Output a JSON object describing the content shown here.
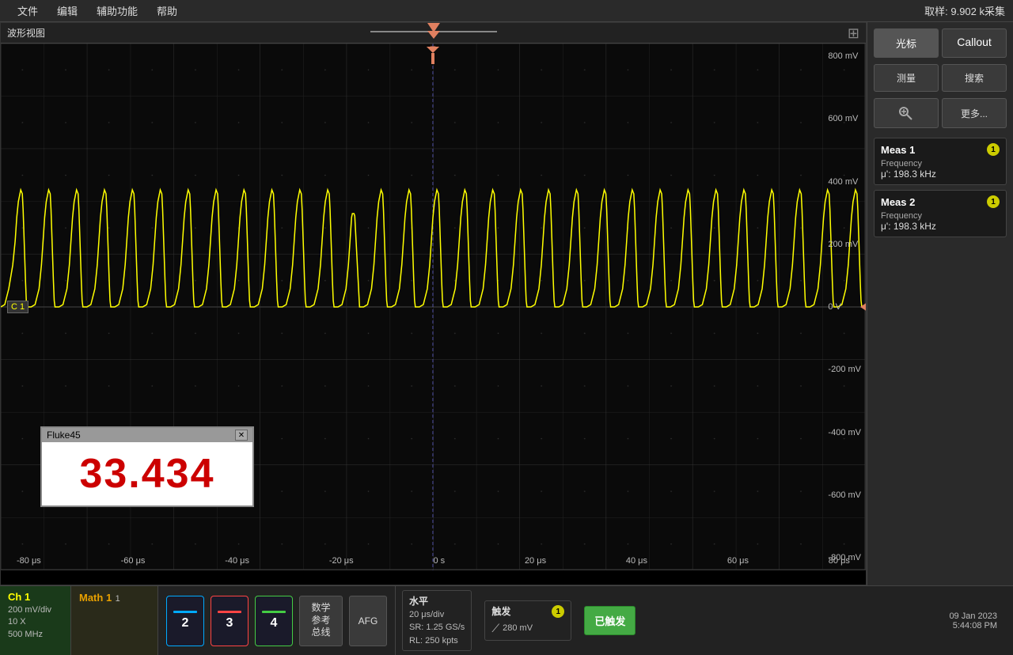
{
  "menubar": {
    "items": [
      "文件",
      "编辑",
      "辅助功能",
      "帮助"
    ],
    "sample_info": "取样: 9.902 k采集"
  },
  "right_panel": {
    "btn_cursor": "光标",
    "btn_callout": "Callout",
    "btn_measure": "测量",
    "btn_search": "搜索",
    "btn_zoom_icon": "⊕",
    "btn_more": "更多...",
    "meas1": {
      "title": "Meas 1",
      "badge": "1",
      "label1": "Frequency",
      "value1": "μ': 198.3 kHz"
    },
    "meas2": {
      "title": "Meas 2",
      "badge": "1",
      "label1": "Frequency",
      "value1": "μ': 198.3 kHz"
    }
  },
  "waveform": {
    "title": "波形视图",
    "y_labels": [
      "800 mV",
      "600 mV",
      "400 mV",
      "200 mV",
      "0 V",
      "-200 mV",
      "-400 mV",
      "-600 mV",
      "-800 mV"
    ],
    "x_labels": [
      "-80 μs",
      "-60 μs",
      "-40 μs",
      "-20 μs",
      "0 s",
      "20 μs",
      "40 μs",
      "60 μs",
      "80 μs"
    ],
    "ch1_label": "C 1"
  },
  "fluke_popup": {
    "title": "Fluke45",
    "close": "✕",
    "value": "33.434"
  },
  "bottom_bar": {
    "ch1": {
      "title": "Ch 1",
      "line1": "200 mV/div",
      "line2": "10 X",
      "line3": "500 MHz"
    },
    "math1": {
      "title": "Math 1",
      "value": "1"
    },
    "ch_buttons": [
      {
        "num": "2",
        "color": "#00aaff"
      },
      {
        "num": "3",
        "color": "#ff4444"
      },
      {
        "num": "4",
        "color": "#44cc44"
      }
    ],
    "math_btn": {
      "line1": "数学",
      "line2": "参考",
      "line3": "总线"
    },
    "afg_btn": "AFG",
    "horiz": {
      "label": "水平",
      "line1": "20 μs/div",
      "line2": "SR: 1.25 GS/s",
      "line3": "RL: 250 kpts"
    },
    "trigger": {
      "label": "触发",
      "badge": "1",
      "icon": "⟋",
      "value": "280 mV"
    },
    "armed_btn": "已触发",
    "datetime": {
      "line1": "09 Jan 2023",
      "line2": "5:44:08 PM"
    }
  }
}
